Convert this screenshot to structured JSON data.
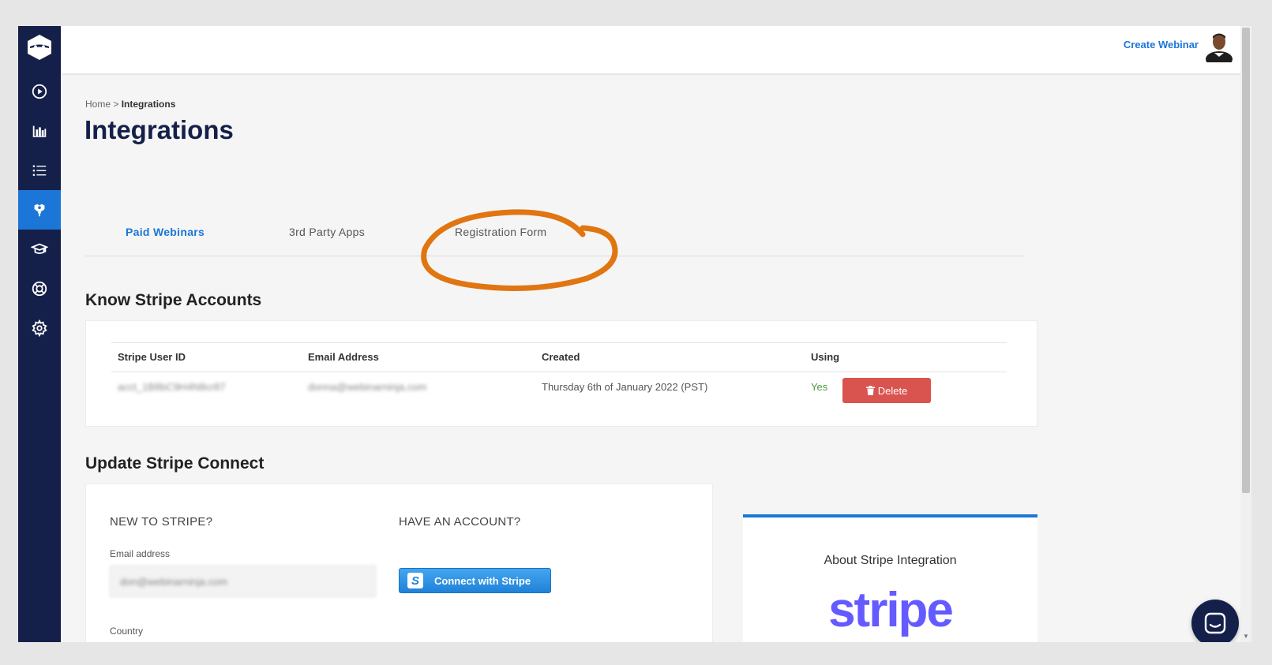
{
  "header": {
    "create_webinar": "Create Webinar"
  },
  "sidebar": {
    "items": [
      {
        "icon": "play-circle-icon"
      },
      {
        "icon": "bar-chart-icon"
      },
      {
        "icon": "list-icon"
      },
      {
        "icon": "integrations-plug-icon",
        "active": true
      },
      {
        "icon": "graduation-cap-icon"
      },
      {
        "icon": "lifebuoy-icon"
      },
      {
        "icon": "gear-icon"
      }
    ],
    "active_color": "#1b76d8",
    "bg_color": "#15204a"
  },
  "breadcrumb": {
    "home": "Home",
    "separator": ">",
    "current": "Integrations"
  },
  "page_title": "Integrations",
  "tabs": [
    {
      "label": "Paid Webinars",
      "active": true
    },
    {
      "label": "3rd Party Apps",
      "active": false
    },
    {
      "label": "Registration Form",
      "active": false
    }
  ],
  "accounts_section": {
    "title": "Know Stripe Accounts",
    "columns": [
      "Stripe User ID",
      "Email Address",
      "Created",
      "Using"
    ],
    "rows": [
      {
        "user_id": "acct_1B8bC9H4N8cr87",
        "email": "donna@webinarninja.com",
        "created": "Thursday 6th of January 2022 (PST)",
        "using": "Yes",
        "delete_label": "Delete"
      }
    ]
  },
  "connect_section": {
    "title": "Update Stripe Connect",
    "new_heading": "NEW TO STRIPE?",
    "email_label": "Email address",
    "email_value": "don@webinarninja.com",
    "country_label": "Country",
    "account_heading": "HAVE AN ACCOUNT?",
    "connect_button": "Connect with Stripe"
  },
  "about_section": {
    "title": "About Stripe Integration",
    "logo_text": "stripe",
    "logo_color": "#635bff"
  },
  "annotation": {
    "ring_color": "#e07511"
  },
  "accent_color": "#1b76d8",
  "delete_color": "#d9534f"
}
